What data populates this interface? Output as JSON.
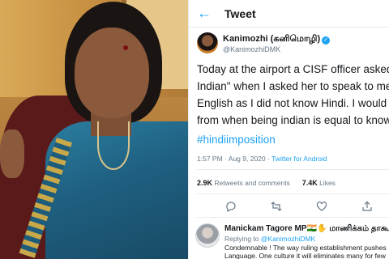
{
  "header": {
    "back_icon": "back-arrow-icon",
    "title": "Tweet"
  },
  "author": {
    "name": "Kanimozhi (கனிமொழி)",
    "handle": "@KanimozhiDMK",
    "verified_icon": "verified-badge-icon"
  },
  "tweet": {
    "lines": [
      "Today at the airport a CISF officer asked",
      "Indian\" when I asked her to speak to me",
      "English as I did not know Hindi. I would",
      "from when being indian is equal to know"
    ],
    "hashtag": "#hindiimposition",
    "time": "1:57 PM",
    "date": "Aug 9, 2020",
    "separator": "·",
    "source": "Twitter for Android"
  },
  "stats": {
    "retweets_count": "2.9K",
    "retweets_label": "Retweets and comments",
    "likes_count": "7.4K",
    "likes_label": "Likes"
  },
  "actions": [
    "reply-icon",
    "retweet-icon",
    "like-icon",
    "share-icon"
  ],
  "reply": {
    "name": "Manickam Tagore MP🇮🇳✋ மாணிக்கம் தாகூர",
    "replying_prefix": "Replying to",
    "replying_handle": "@KanimozhiDMK",
    "text_line1": "Condemnable ! The way ruling establishment pushes",
    "text_line2": "Language. One culture it will eliminates many for few"
  },
  "colors": {
    "accent": "#1da1f2",
    "secondary_text": "#657786",
    "primary_text": "#14171a"
  }
}
